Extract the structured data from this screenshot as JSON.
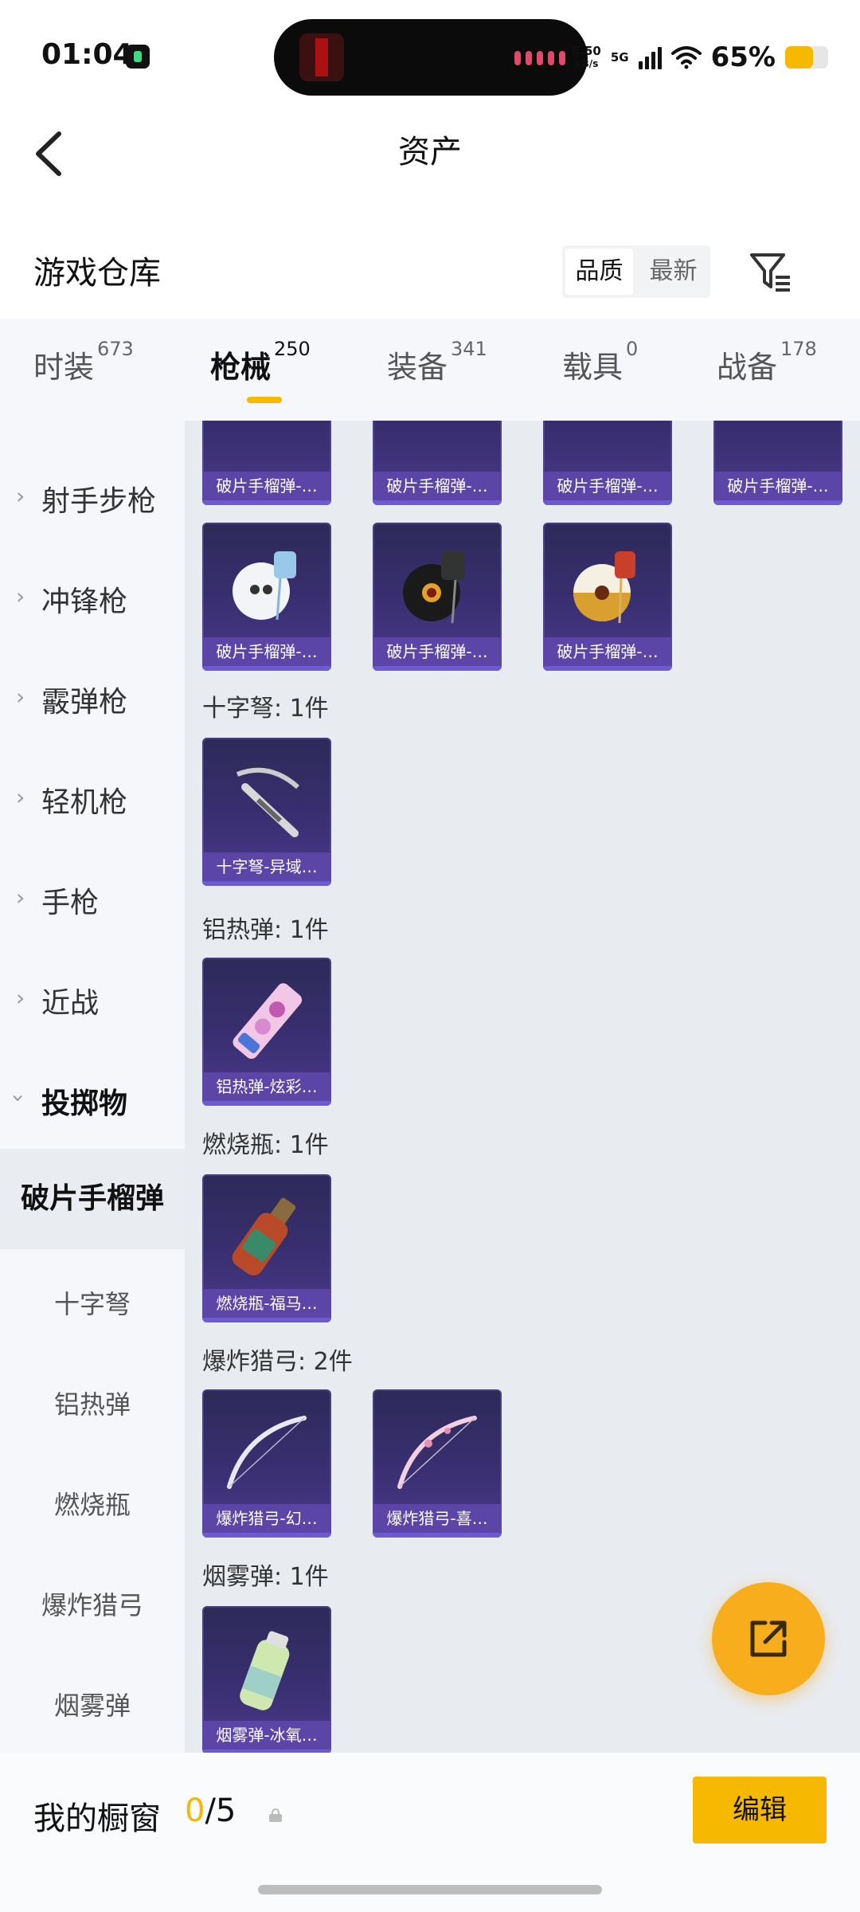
{
  "status_bar": {
    "time": "01:04",
    "net_speed": "6.50",
    "net_unit": "KB/s",
    "network": "5G",
    "battery": "65%",
    "battery_level": 0.65,
    "accent": "#f6b800"
  },
  "header": {
    "title": "资产",
    "back_icon": "chevron-left-icon"
  },
  "warehouse": {
    "title": "游戏仓库",
    "sort_options": [
      "品质",
      "最新"
    ],
    "sort_selected": "品质",
    "filter_icon": "filter-icon"
  },
  "tabs": [
    {
      "label": "时装",
      "count": "673"
    },
    {
      "label": "枪械",
      "count": "250",
      "active": true
    },
    {
      "label": "装备",
      "count": "341"
    },
    {
      "label": "载具",
      "count": "0"
    },
    {
      "label": "战备",
      "count": "178"
    }
  ],
  "sidebar": {
    "categories": [
      "射手步枪",
      "冲锋枪",
      "霰弹枪",
      "轻机枪",
      "手枪",
      "近战",
      "投掷物"
    ],
    "subcategories": [
      "破片手榴弹",
      "十字弩",
      "铝热弹",
      "燃烧瓶",
      "爆炸猎弓",
      "烟雾弹"
    ],
    "active_sub": "破片手榴弹"
  },
  "groups": [
    {
      "title": "",
      "items": [
        "破片手榴弹-…",
        "破片手榴弹-…",
        "破片手榴弹-…",
        "破片手榴弹-…"
      ]
    },
    {
      "title": "",
      "items": [
        "破片手榴弹-…",
        "破片手榴弹-…",
        "破片手榴弹-…"
      ]
    },
    {
      "title": "十字弩: 1件",
      "items": [
        "十字弩-异域…"
      ]
    },
    {
      "title": "铝热弹: 1件",
      "items": [
        "铝热弹-炫彩…"
      ]
    },
    {
      "title": "燃烧瓶: 1件",
      "items": [
        "燃烧瓶-福马…"
      ]
    },
    {
      "title": "爆炸猎弓: 2件",
      "items": [
        "爆炸猎弓-幻…",
        "爆炸猎弓-喜…"
      ]
    },
    {
      "title": "烟雾弹: 1件",
      "items": [
        "烟雾弹-冰氧…"
      ]
    }
  ],
  "bottom": {
    "label": "我的橱窗",
    "current": "0",
    "total": "/5",
    "edit_label": "编辑"
  }
}
